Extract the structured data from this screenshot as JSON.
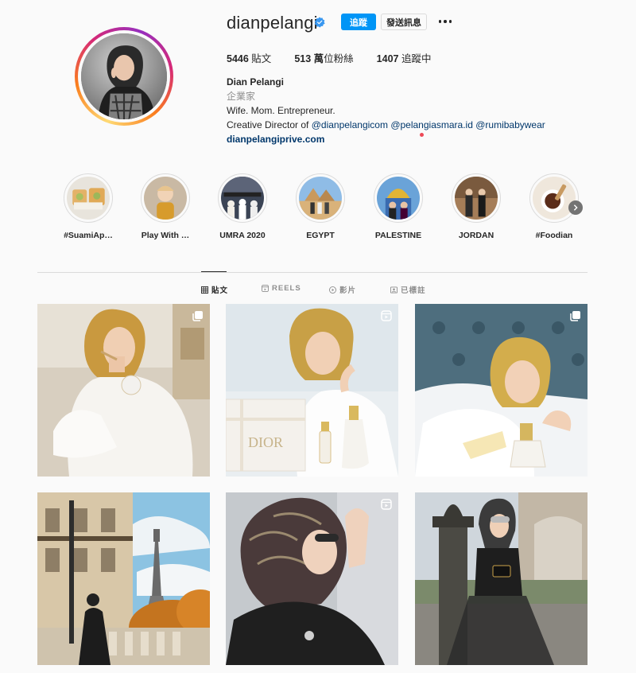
{
  "profile": {
    "username": "dianpelangi",
    "follow_label": "追蹤",
    "message_label": "發送訊息",
    "more_icon": "more-horizontal-icon",
    "stats": {
      "posts": "5446",
      "posts_label": "貼文",
      "followers": "513 萬",
      "followers_label": "位粉絲",
      "following": "1407",
      "following_label": "追蹤中"
    },
    "bio": {
      "name": "Dian Pelangi",
      "category": "企業家",
      "line1": "Wife. Mom. Entrepreneur.",
      "line2_prefix": "Creative Director of",
      "mention1": "@dianpelangicom",
      "mention2": "@pelangiasmara.id",
      "mention3": "@rumibabywear",
      "website": "dianpelangiprive.com"
    }
  },
  "highlights": [
    {
      "label": "#SuamiAp…"
    },
    {
      "label": "Play With …"
    },
    {
      "label": "UMRA 2020"
    },
    {
      "label": "EGYPT"
    },
    {
      "label": "PALESTINE"
    },
    {
      "label": "JORDAN"
    },
    {
      "label": "#Foodian"
    }
  ],
  "tabs": [
    {
      "label": "貼文",
      "icon": "grid-icon",
      "active": true
    },
    {
      "label": "REELS",
      "icon": "reels-icon",
      "active": false
    },
    {
      "label": "影片",
      "icon": "video-icon",
      "active": false
    },
    {
      "label": "已標註",
      "icon": "tagged-icon",
      "active": false
    }
  ],
  "posts": [
    {
      "type": "carousel",
      "icon": "carousel-icon"
    },
    {
      "type": "reel",
      "icon": "reel-icon"
    },
    {
      "type": "carousel",
      "icon": "carousel-icon"
    },
    {
      "type": "image",
      "icon": ""
    },
    {
      "type": "reel",
      "icon": "reel-icon"
    },
    {
      "type": "image",
      "icon": ""
    }
  ],
  "colors": {
    "primary_button": "#0095f6",
    "link": "#00376b",
    "verified": "#3897f0",
    "notification_dot": "#ed4956"
  }
}
